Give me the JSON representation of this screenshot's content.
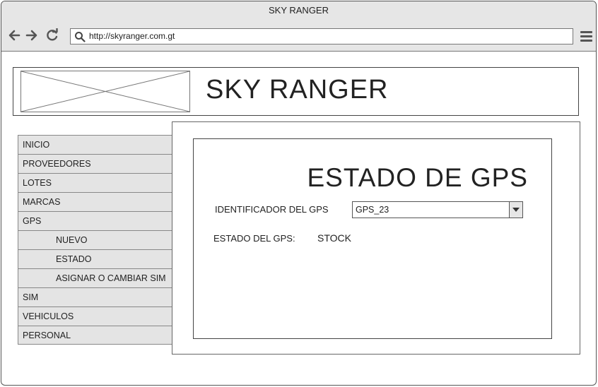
{
  "window": {
    "title": "SKY RANGER"
  },
  "browser": {
    "url": "http://skyranger.com.gt"
  },
  "header": {
    "brand": "SKY RANGER"
  },
  "sidebar": {
    "items": [
      {
        "label": "INICIO"
      },
      {
        "label": "PROVEEDORES"
      },
      {
        "label": "LOTES"
      },
      {
        "label": "MARCAS"
      },
      {
        "label": "GPS"
      },
      {
        "label": "NUEVO"
      },
      {
        "label": "ESTADO"
      },
      {
        "label": "ASIGNAR O CAMBIAR SIM"
      },
      {
        "label": "SIM"
      },
      {
        "label": "VEHICULOS"
      },
      {
        "label": "PERSONAL"
      }
    ]
  },
  "main": {
    "title": "ESTADO DE GPS",
    "gps_id_label": "IDENTIFICADOR DEL GPS",
    "gps_id_value": "GPS_23",
    "status_label": "ESTADO DEL GPS:",
    "status_value": "STOCK"
  }
}
